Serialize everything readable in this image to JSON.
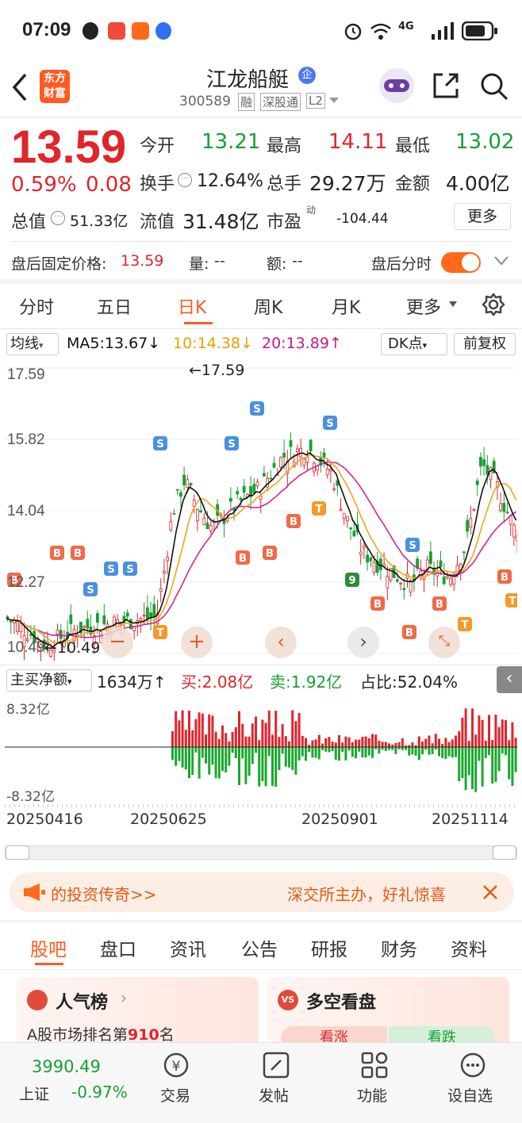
{
  "status_bar": {
    "time": "07:09",
    "network": "4G"
  },
  "header": {
    "stock_name": "江龙船艇",
    "badge": "企",
    "code": "300589",
    "tags": [
      "融",
      "深股通",
      "L2"
    ],
    "logo_text": "东方财富"
  },
  "quote": {
    "price": "13.59",
    "change_pct": "0.59%",
    "change": "0.08",
    "today_open_label": "今开",
    "today_open": "13.21",
    "high_label": "最高",
    "high": "14.11",
    "low_label": "最低",
    "low": "13.02",
    "turnover_label": "换手",
    "turnover": "12.64%",
    "volume_label": "总手",
    "volume": "29.27万",
    "amount_label": "金额",
    "amount": "4.00亿",
    "total_mv_label": "总值",
    "total_mv": "51.33亿",
    "float_mv_label": "流值",
    "float_mv": "31.48亿",
    "pe_label": "市盈",
    "pe_sup": "动",
    "pe": "-104.44",
    "more_label": "更多"
  },
  "after_hours": {
    "fixed_price_label": "盘后固定价格:",
    "fixed_price": "13.59",
    "vol_label": "量:",
    "vol": "--",
    "amt_label": "额:",
    "amt": "--",
    "toggle_label": "盘后分时"
  },
  "period_tabs": [
    "分时",
    "五日",
    "日K",
    "周K",
    "月K",
    "更多"
  ],
  "active_tab": 2,
  "indicator_bar": {
    "ma_select": "均线",
    "ma5": "MA5:13.67↓",
    "ma10": "10:14.38↓",
    "ma20": "20:13.89↑",
    "dk": "DK点",
    "adjust": "前复权"
  },
  "kline": {
    "y_labels": [
      "17.59",
      "15.82",
      "14.04",
      "12.27",
      "10.49"
    ],
    "max_marker": "←17.59",
    "min_marker": "←10.49",
    "colors": {
      "up": "#e0252b",
      "down": "#16a034",
      "ma5": "#111111",
      "ma10": "#f2a516",
      "ma20": "#d1259a"
    }
  },
  "fund_flow": {
    "select": "主买净额",
    "net": "1634万↑",
    "buy": "买:2.08亿",
    "sell": "卖:1.92亿",
    "ratio": "占比:52.04%",
    "y_top": "8.32亿",
    "y_bottom": "-8.32亿",
    "dates": [
      "20250416",
      "20250625",
      "20250901",
      "20251114"
    ]
  },
  "banner": {
    "left_text": "的投资传奇>>",
    "right_text": "深交所主办，好礼惊喜"
  },
  "content_tabs": [
    "股吧",
    "盘口",
    "资讯",
    "公告",
    "研报",
    "财务",
    "资料"
  ],
  "cards": {
    "popularity_title": "人气榜",
    "popularity_sub_prefix": "A股市场排名第",
    "popularity_rank": "910",
    "popularity_sub_suffix": "名",
    "duokong_title": "多空看盘",
    "bull": "看涨",
    "bear": "看跌"
  },
  "bottom_nav": {
    "index_value": "3990.49",
    "index_name": "上证",
    "index_change": "-0.97%",
    "items": [
      "交易",
      "发帖",
      "功能",
      "设自选"
    ]
  }
}
